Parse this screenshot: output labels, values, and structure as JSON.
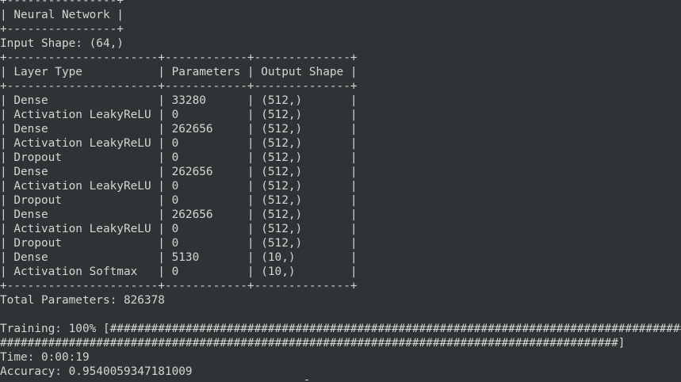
{
  "terminal": {
    "lines": [
      "+----------------+",
      "| Neural Network |",
      "+----------------+",
      "Input Shape: (64,)",
      "+----------------------+------------+--------------+",
      "| Layer Type           | Parameters | Output Shape |",
      "+----------------------+------------+--------------+",
      "| Dense                | 33280      | (512,)       |",
      "| Activation LeakyReLU | 0          | (512,)       |",
      "| Dense                | 262656     | (512,)       |",
      "| Activation LeakyReLU | 0          | (512,)       |",
      "| Dropout              | 0          | (512,)       |",
      "| Dense                | 262656     | (512,)       |",
      "| Activation LeakyReLU | 0          | (512,)       |",
      "| Dropout              | 0          | (512,)       |",
      "| Dense                | 262656     | (512,)       |",
      "| Activation LeakyReLU | 0          | (512,)       |",
      "| Dropout              | 0          | (512,)       |",
      "| Dense                | 5130       | (10,)        |",
      "| Activation Softmax   | 0          | (10,)        |",
      "+----------------------+------------+--------------+",
      "Total Parameters: 826378",
      "",
      "Training: 100% [##########################################################################################",
      "##########################################################################################]",
      "Time: 0:00:19",
      "Accuracy: 0.9540059347181009"
    ]
  }
}
